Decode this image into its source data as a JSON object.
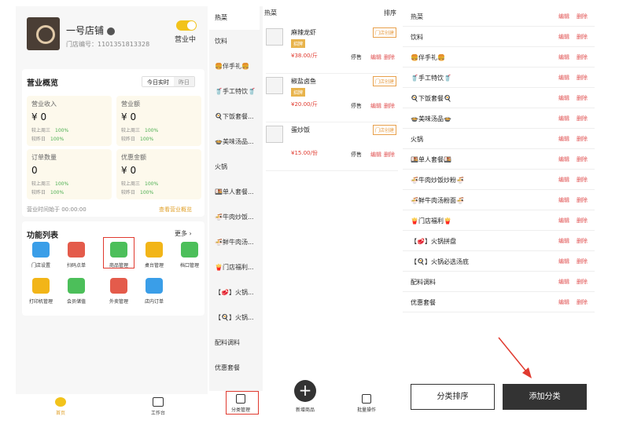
{
  "store": {
    "name": "一号店铺",
    "id_label": "门店编号：1101351813328",
    "status": "营业中"
  },
  "overview": {
    "title": "营业概览",
    "tabs": [
      "今日实时",
      "昨日"
    ],
    "stats": [
      {
        "label": "营业收入",
        "value": "¥ 0",
        "r1": "较上周三",
        "r1_pct": "100%",
        "r2": "较昨日",
        "r2_pct": "100%"
      },
      {
        "label": "营业额",
        "value": "¥ 0",
        "r1": "较上周三",
        "r1_pct": "100%",
        "r2": "较昨日",
        "r2_pct": "100%"
      },
      {
        "label": "订单数量",
        "value": "0",
        "r1": "较上周三",
        "r1_pct": "100%",
        "r2": "较昨日",
        "r2_pct": "100%"
      },
      {
        "label": "优惠金额",
        "value": "¥ 0",
        "r1": "较上周三",
        "r1_pct": "100%",
        "r2": "较昨日",
        "r2_pct": "100%"
      }
    ],
    "start_time": "营业时间始于 00:00:00",
    "link": "查看营业概览"
  },
  "functions": {
    "title": "功能列表",
    "more": "更多",
    "items": [
      "门店设置",
      "扫码点单",
      "商品管理",
      "桌台管理",
      "档口管理",
      "打印机管理",
      "会员储值",
      "外卖管理",
      "店内订单"
    ]
  },
  "bottom_nav": [
    "首页",
    "工作台"
  ],
  "middle": {
    "categories": [
      "热菜",
      "饮料",
      "🍔伴手礼🍔",
      "🥤手工特饮🥤",
      "🍳下饭套餐...",
      "🍲美味汤品...",
      "火锅",
      "🍱单人套餐...",
      "🍜牛肉炒饭...",
      "🍜鲜牛肉汤...",
      "🍟门店福利...",
      "【🥩】火锅...",
      "【🍳】火锅...",
      "配料调料",
      "优惠套餐"
    ],
    "head_left": "热菜",
    "head_right": "排序",
    "products": [
      {
        "name": "麻辣龙虾",
        "tag": "招牌",
        "badge": "门店创建",
        "price": "¥38.00/斤",
        "stop": "停售",
        "edit": "编辑",
        "del": "删除"
      },
      {
        "name": "椒盐卤鱼",
        "tag": "招牌",
        "badge": "门店创建",
        "price": "¥20.00/斤",
        "stop": "停售",
        "edit": "编辑",
        "del": "删除"
      },
      {
        "name": "蛋炒饭",
        "tag": "",
        "badge": "门店创建",
        "price": "¥15.00/份",
        "stop": "停售",
        "edit": "编辑",
        "del": "删除"
      }
    ],
    "nav": [
      "分类管理",
      "新增商品",
      "批量操作"
    ]
  },
  "right": {
    "categories": [
      "热菜",
      "饮料",
      "🍔伴手礼🍔",
      "🥤手工特饮🥤",
      "🍳下饭套餐🍳",
      "🍲美味汤品🍲",
      "火锅",
      "🍱单人套餐🍱",
      "🍜牛肉炒饭炒粉🍜",
      "🍜鲜牛肉汤粉面🍜",
      "🍟门店福利🍟",
      "【🥩】火锅拼盘",
      "【🍳】火锅必选汤底",
      "配料调料",
      "优惠套餐"
    ],
    "edit": "编辑",
    "del": "删除",
    "sort_btn": "分类排序",
    "add_btn": "添加分类"
  },
  "colors": {
    "accent": "#f2c31b",
    "danger": "#e05050",
    "highlight_box": "#e03a2f",
    "dark": "#333333"
  }
}
